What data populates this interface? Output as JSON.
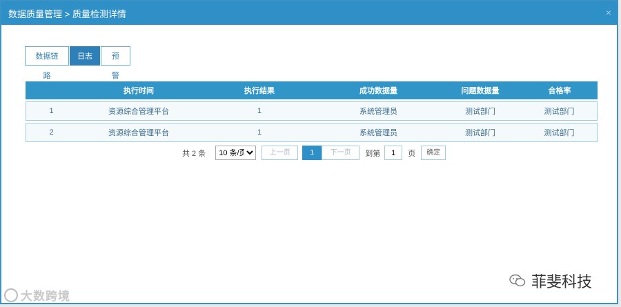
{
  "modal": {
    "title": "数据质量管理 > 质量检测详情",
    "close": "×"
  },
  "tabs": [
    {
      "label": "数据链路",
      "active": false
    },
    {
      "label": "日志",
      "active": true
    },
    {
      "label": "预警",
      "active": false
    }
  ],
  "table": {
    "headers": [
      "",
      "执行时间",
      "执行结果",
      "成功数据量",
      "问题数据量",
      "合格率"
    ],
    "rows": [
      [
        "1",
        "资源综合管理平台",
        "1",
        "系统管理员",
        "测试部门",
        "测试部门"
      ],
      [
        "2",
        "资源综合管理平台",
        "1",
        "系统管理员",
        "测试部门",
        "测试部门"
      ]
    ]
  },
  "pager": {
    "total": "共 2 条",
    "page_size": "10 条/页",
    "prev": "上一页",
    "current": "1",
    "next": "下一页",
    "goto_label": "到第",
    "goto_value": "1",
    "unit": "页",
    "confirm": "确定"
  },
  "watermarks": {
    "left": "大数跨境",
    "right": "菲斐科技"
  },
  "colors": {
    "accent": "#2f8fc7",
    "header": "#3196c7"
  }
}
